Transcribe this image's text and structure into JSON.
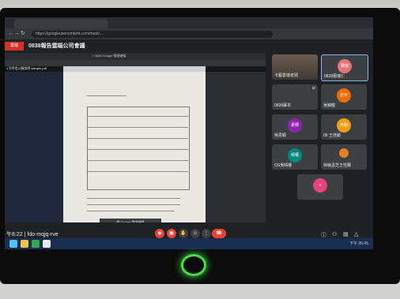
{
  "browser": {
    "tab_label": "",
    "url": "https://googleusercontent.com/meet/...",
    "icons": [
      "back-icon",
      "forward-icon",
      "reload-icon",
      "home-icon"
    ]
  },
  "meet": {
    "badge": "雲端",
    "title": "0838報告雲端公司會議",
    "meeting_time": "午8:22",
    "meeting_code": "fdo-mqjq-rve"
  },
  "presentation": {
    "inner_tab": "○ 0838 Google 雲端硬碟",
    "left_file": "1子評定公開說明 sample.pdf",
    "tooltip": "開 Google 雲端硬碟"
  },
  "participants": [
    {
      "name": "卡藝雲端老頭",
      "avatar": "",
      "color": "#7d6a56"
    },
    {
      "name": "0838鄭瑞仁",
      "avatar": "鄭瑞",
      "color": "#e57373"
    },
    {
      "name": "0838蘇本",
      "avatar": "",
      "color": "#5f6368"
    },
    {
      "name": "吳錦龍",
      "avatar": "志宇",
      "color": "#ef6c00"
    },
    {
      "name": "吳思穎",
      "avatar": "素卿",
      "color": "#8e24aa"
    },
    {
      "name": "05 王佳勳",
      "avatar": "佳勳",
      "color": "#f39c12"
    },
    {
      "name": "OS吳晴權",
      "avatar": "晴權",
      "color": "#00897b"
    },
    {
      "name": "徐敏孟芝王性蘭",
      "avatar": "",
      "color": "#e67e22"
    },
    {
      "name": "",
      "avatar": "",
      "color": "#ec407a"
    }
  ],
  "controls": {
    "left": [
      "mic-off-icon",
      "camera-off-icon",
      "hand-icon",
      "emoji-icon",
      "more-icon"
    ],
    "end": "end-call-icon",
    "right": [
      "info-icon",
      "people-icon",
      "chat-icon",
      "activities-icon"
    ]
  },
  "taskbar": {
    "clock": "下午 05:45"
  }
}
